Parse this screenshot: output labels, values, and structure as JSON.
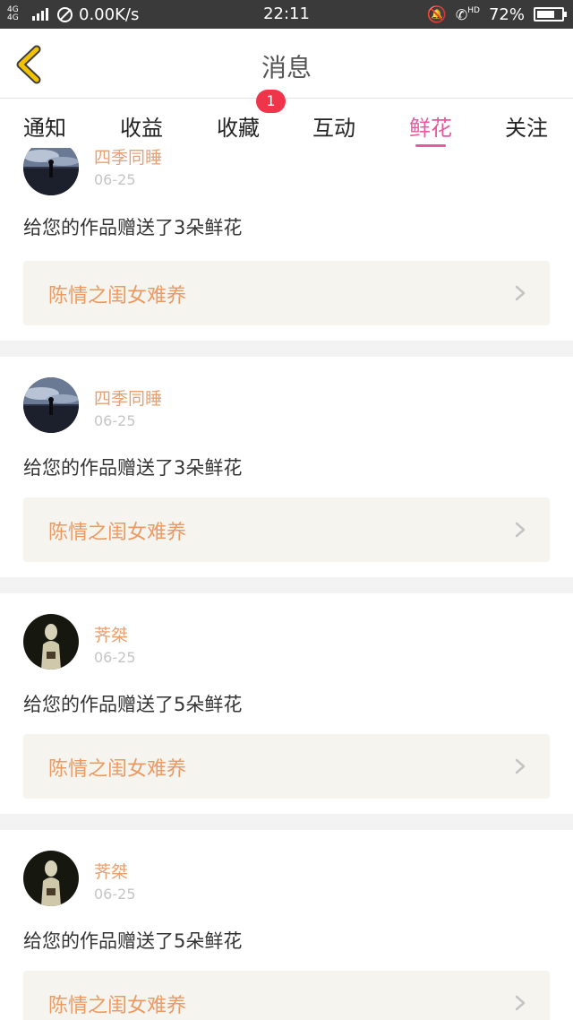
{
  "status_bar": {
    "network": "4G 4G",
    "speed": "0.00K/s",
    "time": "22:11",
    "hd": "HD",
    "battery": "72%",
    "battery_level": 0.72
  },
  "header": {
    "title": "消息"
  },
  "tabs": [
    {
      "label": "通知",
      "active": false
    },
    {
      "label": "收益",
      "active": false
    },
    {
      "label": "收藏",
      "active": false,
      "badge": "1"
    },
    {
      "label": "互动",
      "active": false
    },
    {
      "label": "鲜花",
      "active": true
    },
    {
      "label": "关注",
      "active": false
    }
  ],
  "colors": {
    "accent": "#e55b9e",
    "badge": "#f0354a",
    "username": "#e8a070",
    "work_title": "#ec9a63"
  },
  "items": [
    {
      "user": "四季同睡",
      "date": "06-25",
      "message": "给您的作品赠送了3朵鲜花",
      "work": "陈情之闺女难养"
    },
    {
      "user": "四季同睡",
      "date": "06-25",
      "message": "给您的作品赠送了3朵鲜花",
      "work": "陈情之闺女难养"
    },
    {
      "user": "荠桀",
      "date": "06-25",
      "message": "给您的作品赠送了5朵鲜花",
      "work": "陈情之闺女难养"
    },
    {
      "user": "荠桀",
      "date": "06-25",
      "message": "给您的作品赠送了5朵鲜花",
      "work": "陈情之闺女难养"
    }
  ]
}
